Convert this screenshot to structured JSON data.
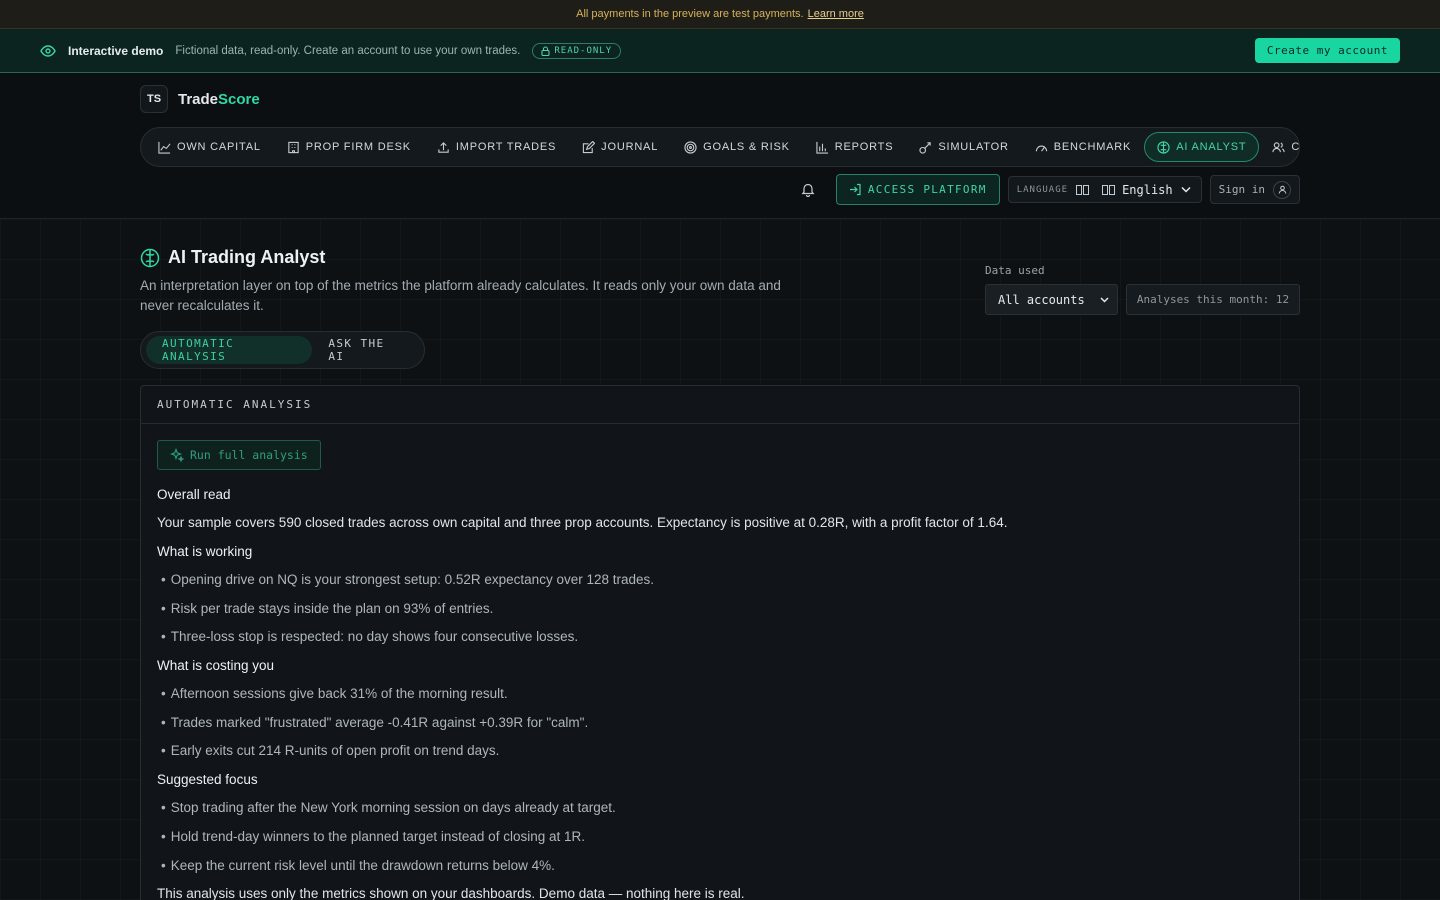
{
  "notice": {
    "text": "All payments in the preview are test payments.",
    "link": "Learn more"
  },
  "demo_bar": {
    "title": "Interactive demo",
    "description": "Fictional data, read-only. Create an account to use your own trades.",
    "badge": "READ-ONLY",
    "cta": "Create my account"
  },
  "brand": {
    "logo_text": "TS",
    "name_part1": "Trade",
    "name_part2": "Score"
  },
  "nav": {
    "items": [
      {
        "label": "OWN CAPITAL",
        "icon": "chart-line-icon"
      },
      {
        "label": "PROP FIRM DESK",
        "icon": "building-icon"
      },
      {
        "label": "IMPORT TRADES",
        "icon": "upload-icon"
      },
      {
        "label": "JOURNAL",
        "icon": "edit-icon"
      },
      {
        "label": "GOALS & RISK",
        "icon": "target-icon"
      },
      {
        "label": "REPORTS",
        "icon": "bar-chart-icon"
      },
      {
        "label": "SIMULATOR",
        "icon": "flask-icon"
      },
      {
        "label": "BENCHMARK",
        "icon": "gauge-icon"
      },
      {
        "label": "AI ANALYST",
        "icon": "brain-icon",
        "active": true
      },
      {
        "label": "COMMU",
        "icon": "users-icon"
      }
    ]
  },
  "toolbar": {
    "access_label": "ACCESS PLATFORM",
    "language_label": "LANGUAGE",
    "language_value": "English",
    "signin_label": "Sign in"
  },
  "page": {
    "title": "AI Trading Analyst",
    "subtitle": "An interpretation layer on top of the metrics the platform already calculates. It reads only your own data and never recalculates it.",
    "data_used_label": "Data used",
    "account_select": "All accounts",
    "analyses_count": "Analyses this month: 12",
    "tabs": [
      "AUTOMATIC ANALYSIS",
      "ASK THE AI"
    ]
  },
  "panel": {
    "heading": "AUTOMATIC ANALYSIS",
    "run_button": "Run full analysis",
    "overall_title": "Overall read",
    "overall_text": "Your sample covers 590 closed trades across own capital and three prop accounts. Expectancy is positive at 0.28R, with a profit factor of 1.64.",
    "working_title": "What is working",
    "working": [
      "Opening drive on NQ is your strongest setup: 0.52R expectancy over 128 trades.",
      "Risk per trade stays inside the plan on 93% of entries.",
      "Three-loss stop is respected: no day shows four consecutive losses."
    ],
    "costing_title": "What is costing you",
    "costing": [
      "Afternoon sessions give back 31% of the morning result.",
      "Trades marked \"frustrated\" average -0.41R against +0.39R for \"calm\".",
      "Early exits cut 214 R-units of open profit on trend days."
    ],
    "focus_title": "Suggested focus",
    "focus": [
      "Stop trading after the New York morning session on days already at target.",
      "Hold trend-day winners to the planned target instead of closing at 1R.",
      "Keep the current risk level until the drawdown returns below 4%."
    ],
    "footnote": "This analysis uses only the metrics shown on your dashboards. Demo data — nothing here is real."
  },
  "colors": {
    "accent": "#19d6a0",
    "background": "#0d1114",
    "notice": "#d6b25a"
  }
}
